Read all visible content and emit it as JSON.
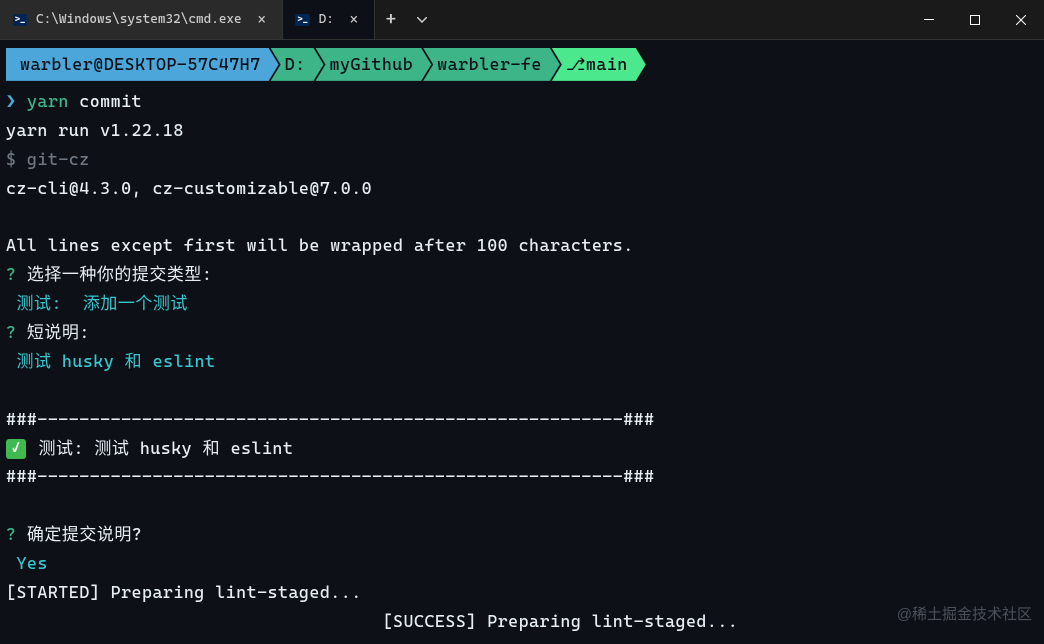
{
  "titlebar": {
    "tabs": [
      {
        "label": "C:\\Windows\\system32\\cmd.exe",
        "active": false
      },
      {
        "label": "D:",
        "active": true
      }
    ]
  },
  "breadcrumb": {
    "user": "warbler@DESKTOP-57C47H7",
    "drive": "D:",
    "folder1": "myGithub",
    "folder2": "warbler-fe",
    "branch": "⎇main"
  },
  "terminal": {
    "prompt": "❯",
    "cmd1": "yarn",
    "cmd1_arg": " commit",
    "line2": "yarn run v1.22.18",
    "line3_prompt": "$",
    "line3": " git-cz",
    "line4": "cz-cli@4.3.0, cz-customizable@7.0.0",
    "line5": "",
    "line6": "All lines except first will be wrapped after 100 characters.",
    "q1_mark": "?",
    "q1": " 选择一种你的提交类型:",
    "a1": " 测试:  添加一个测试",
    "q2_mark": "?",
    "q2": " 短说明:",
    "a2": " 测试 husky 和 eslint",
    "divider1": "###--------------------------------------------------------###",
    "commit_msg": " 测试: 测试 husky 和 eslint",
    "divider2": "###--------------------------------------------------------###",
    "q3_mark": "?",
    "q3": " 确定提交说明?",
    "a3": " Yes",
    "line_started": "[STARTED] Preparing lint-staged...",
    "line_success_pad": "                                    ",
    "line_success": "[SUCCESS] Preparing lint-staged..."
  },
  "watermark": "@稀土掘金技术社区"
}
